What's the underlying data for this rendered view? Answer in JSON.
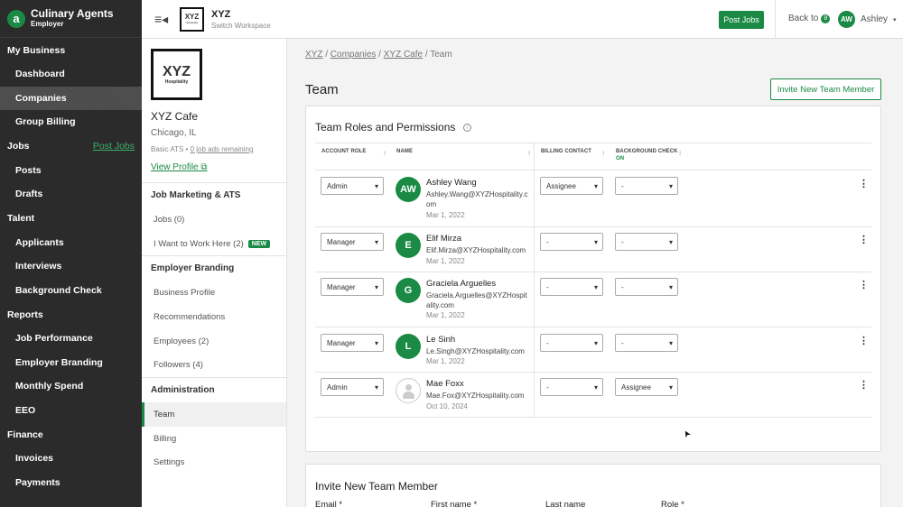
{
  "brand": {
    "name": "Culinary Agents",
    "sub": "Employer",
    "logo_letter": "a"
  },
  "nav": {
    "my_business": "My Business",
    "dashboard": "Dashboard",
    "companies": "Companies",
    "group_billing": "Group Billing",
    "jobs": "Jobs",
    "post_jobs_link": "Post Jobs",
    "posts": "Posts",
    "drafts": "Drafts",
    "talent": "Talent",
    "applicants": "Applicants",
    "interviews": "Interviews",
    "background_check": "Background Check",
    "reports": "Reports",
    "job_performance": "Job Performance",
    "employer_branding": "Employer Branding",
    "monthly_spend": "Monthly Spend",
    "eeo": "EEO",
    "finance": "Finance",
    "invoices": "Invoices",
    "payments": "Payments"
  },
  "topbar": {
    "menu_icon": "≡◂",
    "workspace_name": "XYZ",
    "workspace_sub": "Switch Workspace",
    "logo_big": "XYZ",
    "logo_small": "Hospitality",
    "post_jobs": "Post Jobs",
    "back_to": "Back to",
    "back_count": "8",
    "user_initials": "AW",
    "user_name": "Ashley",
    "caret": "▾"
  },
  "company": {
    "logo_big": "XYZ",
    "logo_small": "Hospitality",
    "name": "XYZ Cafe",
    "location": "Chicago, IL",
    "plan": "Basic ATS •",
    "ads": "0 job ads remaining",
    "view_profile": "View Profile",
    "view_icon": "⧉",
    "sections": {
      "job_marketing": "Job Marketing & ATS",
      "jobs": "Jobs (0)",
      "want_to_work": "I Want to Work Here (2)",
      "new_badge": "NEW",
      "employer_branding": "Employer Branding",
      "business_profile": "Business Profile",
      "recommendations": "Recommendations",
      "employees": "Employees (2)",
      "followers": "Followers (4)",
      "administration": "Administration",
      "team": "Team",
      "billing": "Billing",
      "settings": "Settings"
    }
  },
  "breadcrumb": {
    "xyz": "XYZ",
    "sep1": " / ",
    "companies": "Companies",
    "sep2": " / ",
    "cafe": "XYZ Cafe",
    "sep3": " / ",
    "current": "Team"
  },
  "page_title": "Team",
  "invite_button": "Invite New Team Member",
  "roles_card": {
    "title": "Team Roles and Permissions",
    "info_icon": "i",
    "headers": {
      "account_role": "ACCOUNT ROLE",
      "name": "NAME",
      "billing_contact": "BILLING CONTACT",
      "background_check": "BACKGROUND CHECK",
      "background_check_sub": "ON",
      "sep": "⁝"
    },
    "members": [
      {
        "role": "Admin",
        "initials": "AW",
        "name": "Ashley Wang",
        "email": "Ashley.Wang@XYZHospitality.com",
        "date": "Mar 1, 2022",
        "billing": "Assignee",
        "background": "-"
      },
      {
        "role": "Manager",
        "initials": "E",
        "name": "Elif Mirza",
        "email": "Elif.Mirza@XYZHospitality.com",
        "date": "Mar 1, 2022",
        "billing": "-",
        "background": "-"
      },
      {
        "role": "Manager",
        "initials": "G",
        "name": "Graciela Arguelles",
        "email": "Graciela.Arguelles@XYZHospitality.com",
        "date": "Mar 1, 2022",
        "billing": "-",
        "background": "-"
      },
      {
        "role": "Manager",
        "initials": "L",
        "name": "Le Sinh",
        "email": "Le.Singh@XYZHospitality.com",
        "date": "Mar 1, 2022",
        "billing": "-",
        "background": "-"
      },
      {
        "role": "Admin",
        "initials": "",
        "name": "Mae Foxx",
        "email": "Mae.Fox@XYZHospitality.com",
        "date": "Oct 10, 2024",
        "billing": "-",
        "background": "Assignee"
      }
    ],
    "kebab": "⋮"
  },
  "invite_card": {
    "title": "Invite New Team Member",
    "email": "Email *",
    "first_name": "First name *",
    "last_name": "Last name",
    "role": "Role *"
  },
  "cursor": "➤"
}
